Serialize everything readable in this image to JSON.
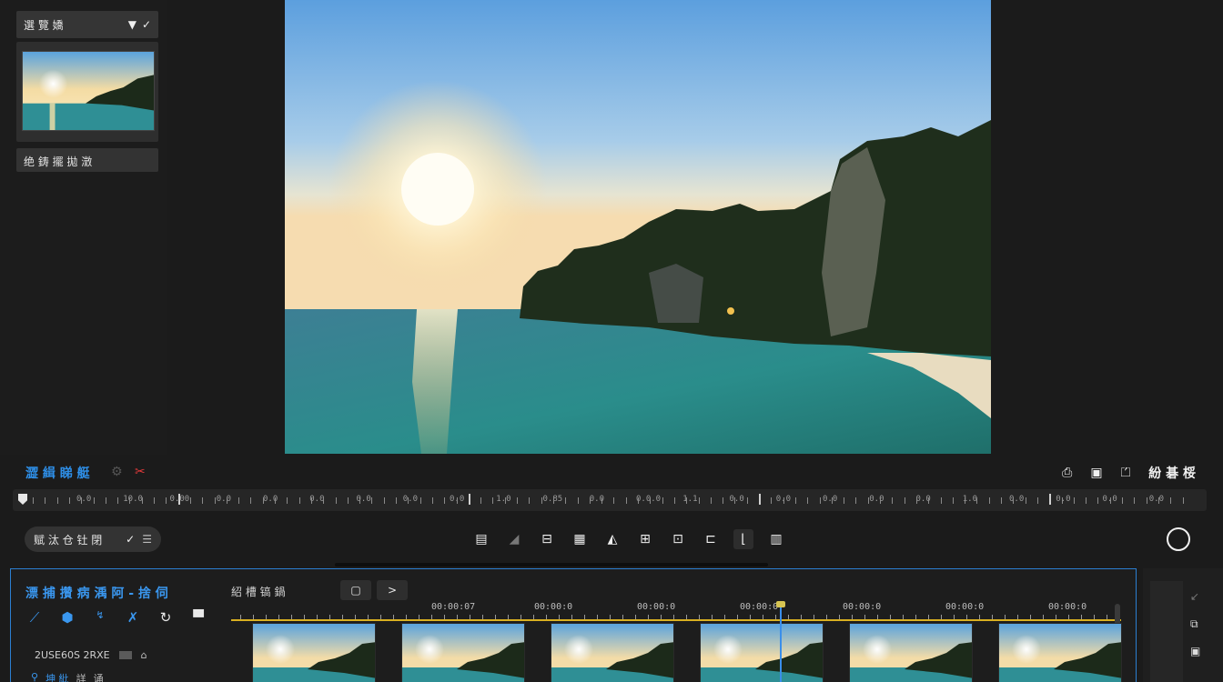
{
  "left_panel": {
    "header_title": "選 覽 嬌",
    "header_icons": [
      "filter-icon",
      "check-icon"
    ],
    "clip_label": "绝 鋳 擺   拋 澂"
  },
  "viewer_status": {
    "left_label": "澀 緝 睇 艇",
    "right_label": "紛 碁 桵"
  },
  "ruler": {
    "labels": [
      "0.0",
      "10.0",
      "0.00",
      "0.0",
      "0.0",
      "0.0",
      "0.0",
      "0.0",
      "0.0",
      "1.0",
      "0.85",
      "0.0",
      "0.0.0",
      "1.1",
      "0.0",
      "0.0",
      "0.0",
      "0.0",
      "0.0",
      "1.0",
      "0.0",
      "0.0",
      "0.0",
      "0.0"
    ]
  },
  "transport": {
    "select_value": "赋 汰 仓 钍 閉",
    "select_chevron": "✓"
  },
  "timeline": {
    "title": "漂 捕 攢 病 渪   阿 - 捨 伺",
    "track_label": "紹 槽 镐 鍋",
    "btn1": "▢",
    "btn2": ">",
    "row2_text": "2USE60S  2RXE",
    "row3_items": [
      "⚲",
      "坤 紕",
      "詳",
      "诵"
    ],
    "ruler_labels": [
      "00:00:07",
      "00:00:0",
      "00:00:0",
      "00:00:0",
      "00:00:0",
      "00:00:0",
      "00:00:0"
    ]
  },
  "colors": {
    "accent": "#2e8fe8",
    "timeline_border": "#2b7fd1",
    "playhead": "#3a8eea",
    "in_out_bar": "#d9b021",
    "cut_icon": "#e33a3a"
  }
}
